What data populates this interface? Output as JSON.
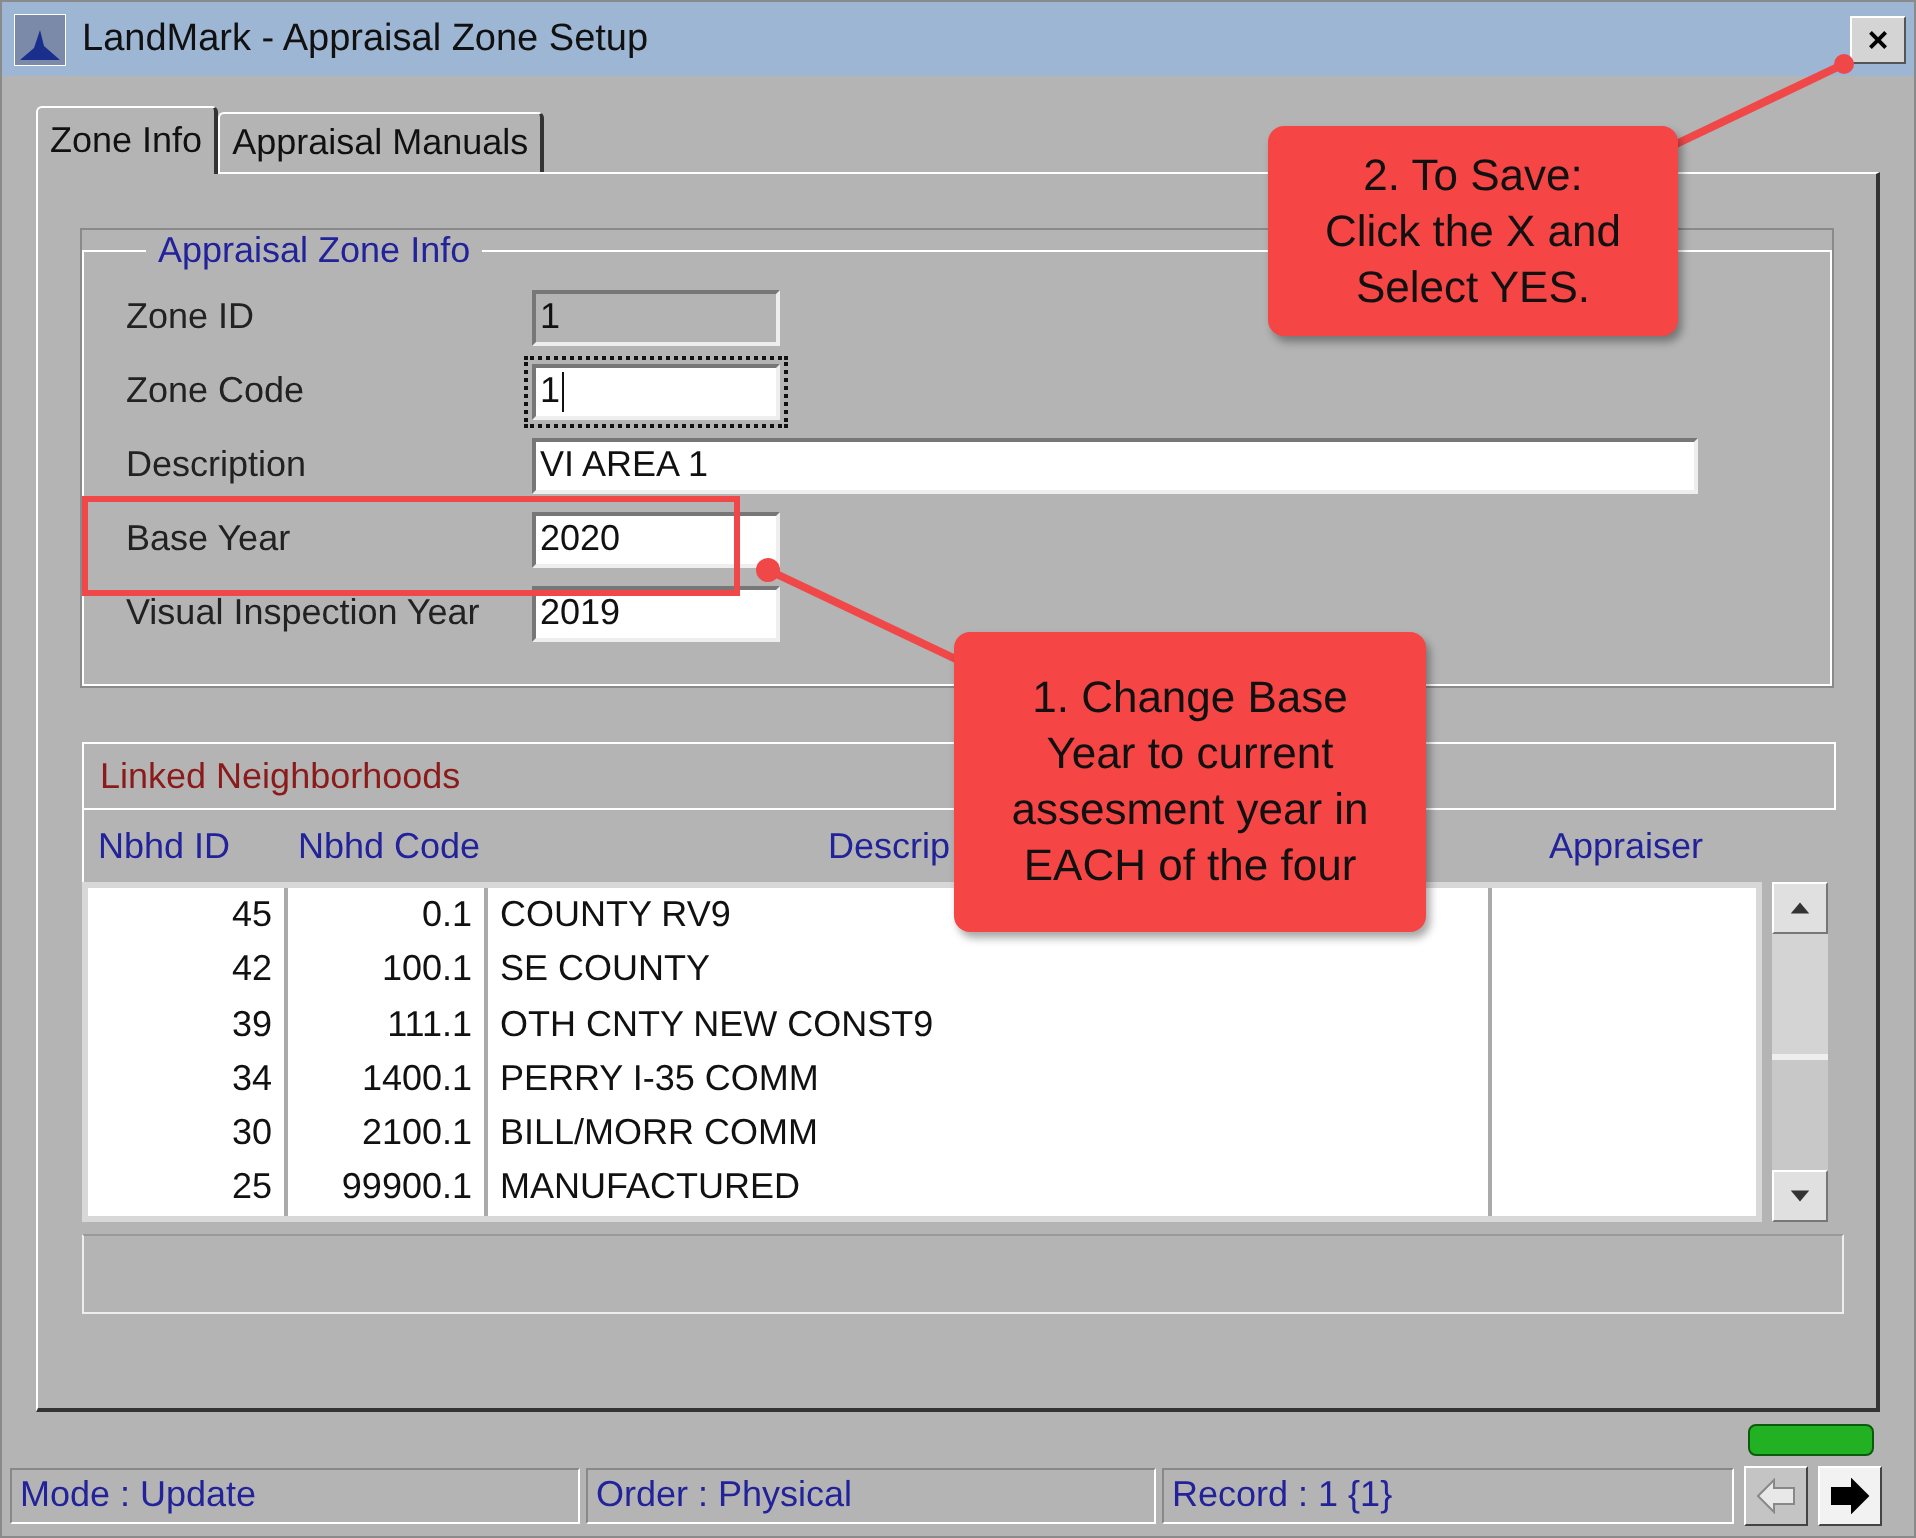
{
  "window": {
    "title": "LandMark - Appraisal Zone Setup",
    "close_button": "×"
  },
  "tabs": [
    {
      "label": "Zone Info",
      "selected": true
    },
    {
      "label": "Appraisal Manuals",
      "selected": false
    }
  ],
  "zone_info": {
    "title": "Appraisal Zone Info",
    "fields": [
      {
        "label": "Zone ID",
        "value": "1",
        "read_only": true,
        "focused": false,
        "wide": false
      },
      {
        "label": "Zone Code",
        "value": "1",
        "read_only": false,
        "focused": true,
        "wide": false
      },
      {
        "label": "Description",
        "value": "VI AREA 1",
        "read_only": false,
        "focused": false,
        "wide": true
      },
      {
        "label": "Base Year",
        "value": "2020",
        "read_only": false,
        "focused": false,
        "wide": false
      },
      {
        "label": "Visual Inspection Year",
        "value": "2019",
        "read_only": false,
        "focused": false,
        "wide": false
      }
    ]
  },
  "neighborhoods": {
    "title": "Linked Neighborhoods",
    "columns": [
      "Nbhd ID",
      "Nbhd Code",
      "Descrip",
      "Appraiser"
    ],
    "rows": [
      {
        "nbhd_id": "45",
        "nbhd_code": "0.1",
        "description": "COUNTY RV9"
      },
      {
        "nbhd_id": "42",
        "nbhd_code": "100.1",
        "description": "SE COUNTY"
      },
      {
        "nbhd_id": "39",
        "nbhd_code": "111.1",
        "description": "OTH CNTY NEW CONST9"
      },
      {
        "nbhd_id": "34",
        "nbhd_code": "1400.1",
        "description": "PERRY I-35 COMM"
      },
      {
        "nbhd_id": "30",
        "nbhd_code": "2100.1",
        "description": "BILL/MORR COMM"
      },
      {
        "nbhd_id": "25",
        "nbhd_code": "99900.1",
        "description": "MANUFACTURED"
      }
    ]
  },
  "status_bar": {
    "panels": [
      "Mode : Update",
      "Order : Physical",
      "Record : 1 {1}"
    ],
    "nav_buttons": [
      {
        "kind": "back",
        "disabled": true
      },
      {
        "kind": "forward",
        "disabled": false
      }
    ]
  },
  "annotations": [
    {
      "kind": "callout",
      "lines": [
        "1. Change Base",
        "Year to current",
        "assesment year in",
        "EACH of the four"
      ]
    },
    {
      "kind": "callout",
      "lines": [
        "2. To Save:",
        "Click the X and",
        "Select YES."
      ]
    },
    {
      "kind": "highlight"
    }
  ]
}
